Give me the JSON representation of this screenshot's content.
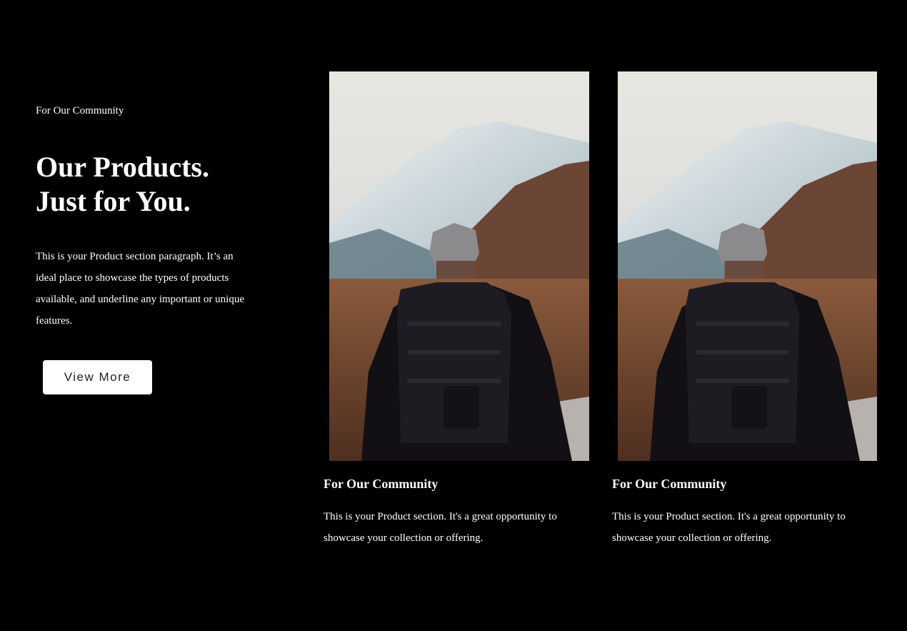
{
  "hero": {
    "eyebrow": "For Our Community",
    "title_line_1": "Our Products.",
    "title_line_2": "Just for You.",
    "paragraph": "This is your Product section paragraph. It’s an ideal place to showcase the types of products available, and underline any important or unique features.",
    "button_label": "View More"
  },
  "products": [
    {
      "image": "hiker-with-backpack-facing-snowy-mountain",
      "title": "For Our Community",
      "description": "This is your Product section. It's a great opportunity to showcase your collection or offering."
    },
    {
      "image": "hiker-with-backpack-facing-snowy-mountain",
      "title": "For Our Community",
      "description": "This is your Product section. It's a great opportunity to showcase your collection or offering."
    }
  ],
  "colors": {
    "background": "#000000",
    "text": "#ffffff",
    "button_background": "#ffffff",
    "button_text": "#222222"
  }
}
